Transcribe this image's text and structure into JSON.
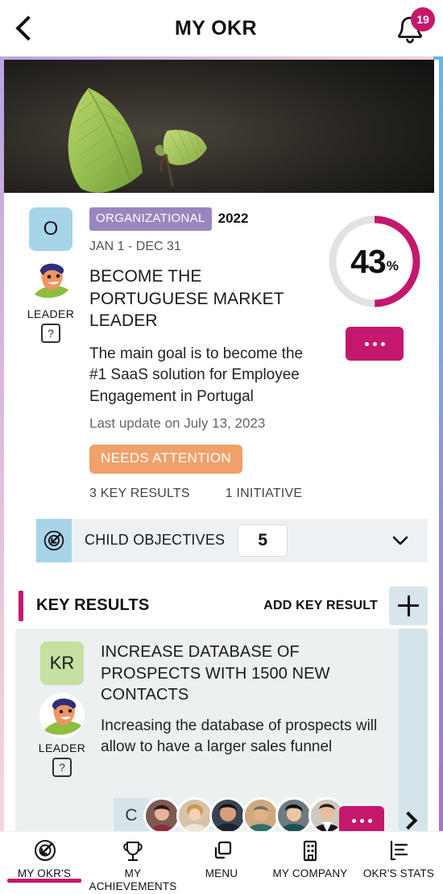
{
  "header": {
    "back_icon": "chevron-left-icon",
    "title": "MY OKR",
    "bell_icon": "bell-icon",
    "notification_count": "19"
  },
  "hero": {
    "alt": "leaf-photo"
  },
  "objective": {
    "type_badge": "O",
    "leader_label": "LEADER",
    "help_mark": "?",
    "category": "ORGANIZATIONAL",
    "year": "2022",
    "date_range": "JAN 1 - DEC 31",
    "title": "BECOME THE PORTUGUESE MARKET LEADER",
    "description": "The main goal is to become the #1 SaaS solution for Employee Engagement in Portugal",
    "last_update": "Last update on July 13, 2023",
    "status": "NEEDS ATTENTION",
    "status_color": "#F0A06A",
    "key_results_count": "3 KEY RESULTS",
    "initiatives_count": "1 INITIATIVE",
    "progress_value": 43,
    "progress_label": "43",
    "progress_unit": "%",
    "progress_color": "#C4186C",
    "progress_track_color": "#E2E2E2",
    "more_button": "...",
    "child_objectives": {
      "icon": "target-arrow-icon",
      "label": "CHILD OBJECTIVES",
      "count": "5",
      "chevron": "chevron-down-icon"
    }
  },
  "key_results_section": {
    "title": "KEY RESULTS",
    "add_label": "ADD KEY RESULT",
    "add_icon": "plus-icon",
    "accent_color": "#C4186C",
    "cards": [
      {
        "type_badge": "KR",
        "leader_label": "LEADER",
        "help_mark": "?",
        "name": "INCREASE DATABASE OF PROSPECTS WITH 1500 NEW CONTACTS",
        "description": "Increasing the database of prospects will allow to have a larger sales funnel",
        "collaborators_label": "C",
        "collaborator_count": 6,
        "more_button": "...",
        "next_icon": "chevron-right-icon"
      }
    ]
  },
  "bottom_nav": {
    "active_index": 0,
    "items": [
      {
        "label": "MY OKR'S",
        "icon": "target-arrow-icon"
      },
      {
        "label": "MY ACHIEVEMENTS",
        "icon": "trophy-icon"
      },
      {
        "label": "MENU",
        "icon": "windows-stack-icon"
      },
      {
        "label": "MY COMPANY",
        "icon": "building-icon"
      },
      {
        "label": "OKR'S STATS",
        "icon": "bar-chart-icon"
      }
    ]
  }
}
